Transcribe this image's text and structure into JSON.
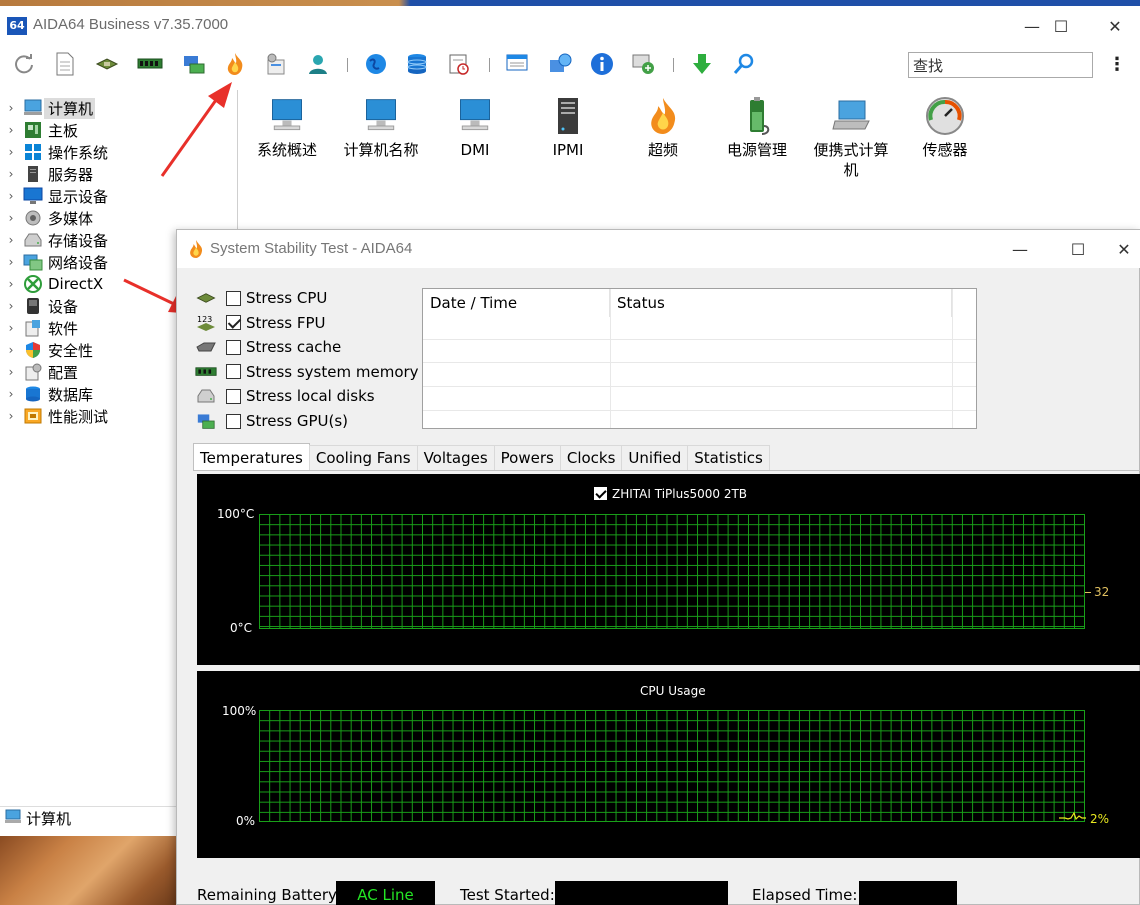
{
  "window": {
    "app_icon_text": "64",
    "title": "AIDA64 Business v7.35.7000",
    "minimize": "—",
    "maximize": "☐",
    "close": "✕"
  },
  "toolbar": {
    "search_placeholder": "查找",
    "search_value": "查找",
    "menu": "⋮",
    "buttons": [
      "refresh",
      "report",
      "cpu",
      "memory",
      "network-card",
      "stress-test",
      "cpuid",
      "user",
      "aida-online",
      "database",
      "scheduler",
      "report-wizard",
      "tools",
      "about",
      "network",
      "download-update",
      "search"
    ]
  },
  "tree": {
    "items": [
      {
        "label": "计算机",
        "icon": "computer-icon",
        "selected": true
      },
      {
        "label": "主板",
        "icon": "motherboard-icon"
      },
      {
        "label": "操作系统",
        "icon": "windows-icon"
      },
      {
        "label": "服务器",
        "icon": "server-icon"
      },
      {
        "label": "显示设备",
        "icon": "monitor-icon"
      },
      {
        "label": "多媒体",
        "icon": "speaker-icon"
      },
      {
        "label": "存储设备",
        "icon": "disk-icon"
      },
      {
        "label": "网络设备",
        "icon": "network-icon"
      },
      {
        "label": "DirectX",
        "icon": "xbox-icon"
      },
      {
        "label": "设备",
        "icon": "device-icon"
      },
      {
        "label": "软件",
        "icon": "software-icon"
      },
      {
        "label": "安全性",
        "icon": "shield-icon"
      },
      {
        "label": "配置",
        "icon": "config-icon"
      },
      {
        "label": "数据库",
        "icon": "database-icon"
      },
      {
        "label": "性能测试",
        "icon": "benchmark-icon"
      }
    ],
    "status_label": "计算机"
  },
  "content_icons": [
    {
      "label": "系统概述",
      "icon": "computer-icon"
    },
    {
      "label": "计算机名称",
      "icon": "computer-icon"
    },
    {
      "label": "DMI",
      "icon": "computer-icon"
    },
    {
      "label": "IPMI",
      "icon": "server-icon"
    },
    {
      "label": "超频",
      "icon": "flame-icon"
    },
    {
      "label": "电源管理",
      "icon": "battery-icon"
    },
    {
      "label": "便携式计算机",
      "icon": "laptop-icon"
    },
    {
      "label": "传感器",
      "icon": "gauge-icon"
    }
  ],
  "dialog": {
    "title": "System Stability Test - AIDA64",
    "stress_options": [
      {
        "label": "Stress CPU",
        "checked": false,
        "icon": "cpu-icon"
      },
      {
        "label": "Stress FPU",
        "checked": true,
        "icon": "fpu-icon"
      },
      {
        "label": "Stress cache",
        "checked": false,
        "icon": "cache-icon"
      },
      {
        "label": "Stress system memory",
        "checked": false,
        "icon": "memory-icon"
      },
      {
        "label": "Stress local disks",
        "checked": false,
        "icon": "disk-icon"
      },
      {
        "label": "Stress GPU(s)",
        "checked": false,
        "icon": "gpu-icon"
      }
    ],
    "log_columns": [
      "Date / Time",
      "Status"
    ],
    "tabs": [
      "Temperatures",
      "Cooling Fans",
      "Voltages",
      "Powers",
      "Clocks",
      "Unified",
      "Statistics"
    ],
    "active_tab": "Temperatures",
    "temp_graph": {
      "legend": "ZHITAI TiPlus5000 2TB",
      "y_max_label": "100°C",
      "y_min_label": "0°C",
      "current_value": "32",
      "value_color": "#e0c060"
    },
    "cpu_graph": {
      "title": "CPU Usage",
      "y_max_label": "100%",
      "y_min_label": "0%",
      "current_value": "2%",
      "value_color": "#e8e820"
    },
    "bottom": {
      "battery_label": "Remaining Battery:",
      "battery_value": "AC Line",
      "test_started_label": "Test Started:",
      "test_started_value": "",
      "elapsed_label": "Elapsed Time:",
      "elapsed_value": ""
    }
  },
  "colors": {
    "grid": "#19a019",
    "accent_blue": "#1a56b8",
    "annotation_arrow": "#e8302a",
    "ac_line": "#24e424"
  }
}
